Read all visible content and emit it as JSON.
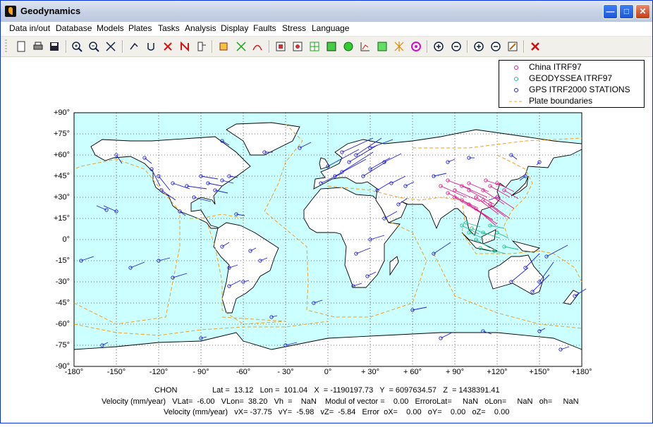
{
  "window": {
    "title": "Geodynamics",
    "buttons": {
      "minimize": "—",
      "maximize": "□",
      "close": "✕"
    }
  },
  "menu": [
    "Data in/out",
    "Database",
    "Models",
    "Plates",
    "Tasks",
    "Analysis",
    "Display",
    "Faults",
    "Stress",
    "Language"
  ],
  "toolbar": {
    "icons": [
      "new-file-icon",
      "print-icon",
      "save-icon",
      "zoom-in-icon",
      "zoom-out-icon",
      "fit-extent-icon",
      "rotate-vector-icon",
      "u-tool-icon",
      "delete-x-icon",
      "delete-n-icon",
      "list-icon",
      "plate-icon",
      "crossing-arrows-icon",
      "curve-arrow-icon",
      "grid-a-icon",
      "grid-b-icon",
      "table-icon",
      "grid-green-icon",
      "recycle-icon",
      "chart-axes-icon",
      "chart-green-icon",
      "stars-icon",
      "circle-target-icon",
      "plus-circle-icon",
      "minus-circle-icon",
      "plus-circle-2-icon",
      "minus-circle-2-icon",
      "edit-icon",
      "exit-icon"
    ]
  },
  "legend": [
    {
      "label": "China ITRF97",
      "color": "#e0198a",
      "marker": "circle"
    },
    {
      "label": "GEODYSSEA ITRF97",
      "color": "#19c08a",
      "marker": "circle"
    },
    {
      "label": "GPS ITRF2000 STATIONS",
      "color": "#2020d0",
      "marker": "circle"
    },
    {
      "label": "Plate boundaries",
      "color": "#f0a020",
      "marker": "dash"
    }
  ],
  "colors": {
    "ocean": "#ccffff",
    "land": "#ffffff",
    "coast": "#000000",
    "plate_boundary": "#f0a020",
    "china": "#e0198a",
    "geodyssea": "#19c08a",
    "gps": "#2020d0"
  },
  "axes": {
    "y_ticks": [
      "+90",
      "+75",
      "+60",
      "+45",
      "+30",
      "+15",
      "0",
      "-15",
      "-30",
      "-45",
      "-60",
      "-75",
      "-90"
    ],
    "x_ticks": [
      "-180",
      "-150",
      "-120",
      "- 90",
      "-60",
      "- 30",
      "0",
      "+ 30",
      "+ 60",
      "+ 90",
      "+120",
      "+150",
      "+180"
    ]
  },
  "map": {
    "xlim": [
      -180,
      180
    ],
    "ylim": [
      -90,
      90
    ],
    "grid": true
  },
  "status": {
    "station": "CHON",
    "line1": "Lat =  13.12   Lon =  101.04   X  = -1190197.73   Y  = 6097634.57   Z  = 1438391.41",
    "line2": "Velocity (mm/year)   VLat=  -6.00   VLon=  38.20   Vh  =    NaN    Modul of vector =    0.00   ErroroLat=     NaN   oLon=     NaN   oh=     NaN",
    "line3": "Velocity (mm/year)   vX= -37.75   vY=  -5.98   vZ=  -5.84   Error  oX=    0.00   oY=    0.00   oZ=    0.00"
  }
}
